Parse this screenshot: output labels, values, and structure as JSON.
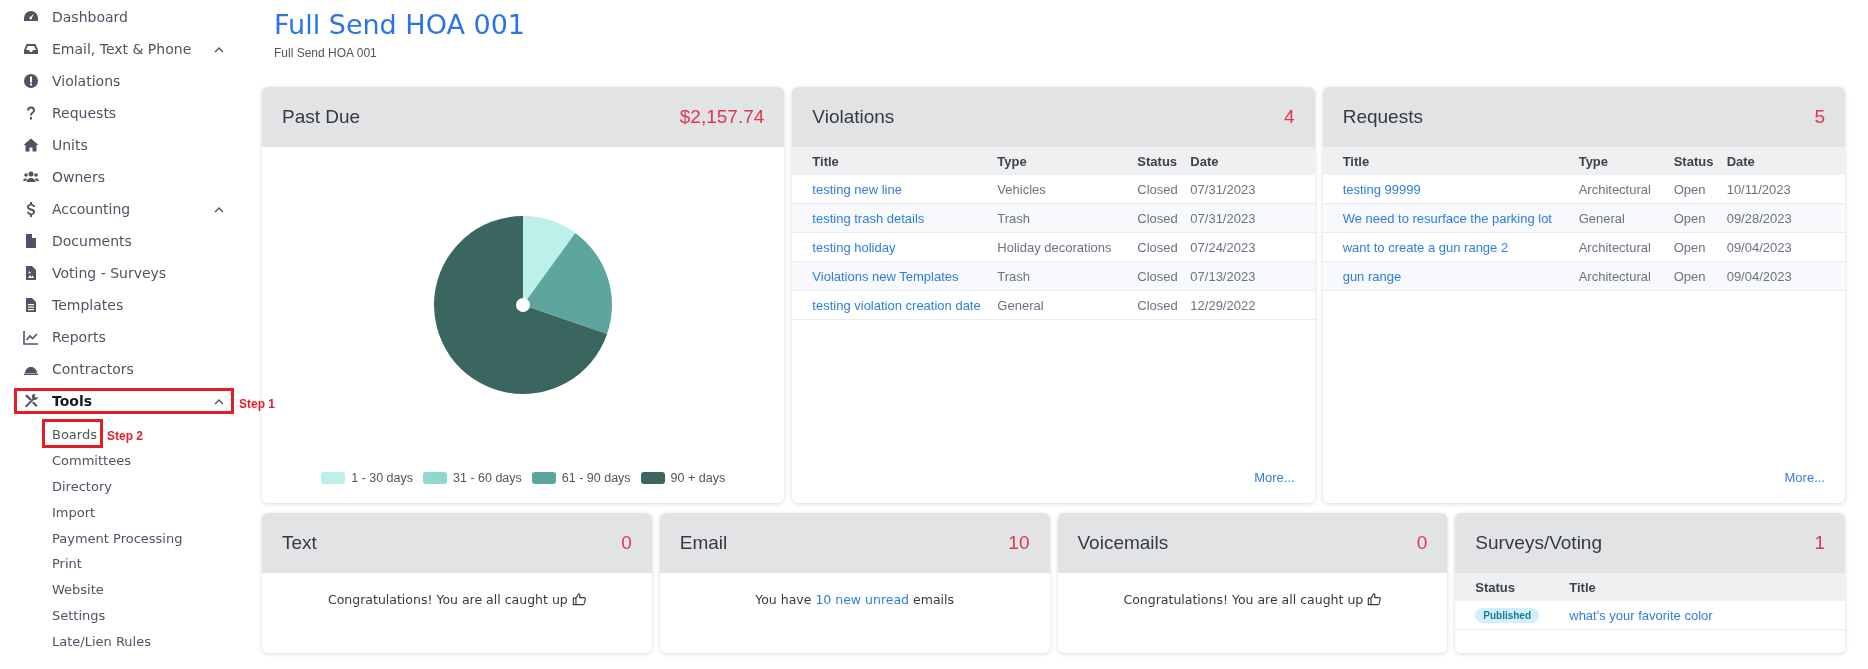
{
  "sidebar": {
    "items": [
      {
        "label": "Dashboard",
        "expanded": false,
        "active": false
      },
      {
        "label": "Email, Text & Phone",
        "expanded": true,
        "active": false
      },
      {
        "label": "Violations",
        "expanded": false,
        "active": false
      },
      {
        "label": "Requests",
        "expanded": false,
        "active": false
      },
      {
        "label": "Units",
        "expanded": false,
        "active": false
      },
      {
        "label": "Owners",
        "expanded": false,
        "active": false
      },
      {
        "label": "Accounting",
        "expanded": true,
        "active": false
      },
      {
        "label": "Documents",
        "expanded": false,
        "active": false
      },
      {
        "label": "Voting - Surveys",
        "expanded": false,
        "active": false
      },
      {
        "label": "Templates",
        "expanded": false,
        "active": false
      },
      {
        "label": "Reports",
        "expanded": false,
        "active": false
      },
      {
        "label": "Contractors",
        "expanded": false,
        "active": false
      },
      {
        "label": "Tools",
        "expanded": true,
        "active": true,
        "annotation": "Step 1",
        "children": [
          {
            "label": "Boards",
            "annotation": "Step 2"
          },
          {
            "label": "Committees"
          },
          {
            "label": "Directory"
          },
          {
            "label": "Import"
          },
          {
            "label": "Payment Processing"
          },
          {
            "label": "Print"
          },
          {
            "label": "Website"
          },
          {
            "label": "Settings"
          },
          {
            "label": "Late/Lien Rules"
          }
        ]
      }
    ]
  },
  "header": {
    "title": "Full Send HOA 001",
    "subtitle": "Full Send HOA 001"
  },
  "past_due": {
    "title": "Past Due",
    "total": "$2,157.74",
    "legend": [
      {
        "label": "1 - 30 days",
        "color": "#bdf0e8"
      },
      {
        "label": "31 - 60 days",
        "color": "#8fd8cc"
      },
      {
        "label": "61 - 90 days",
        "color": "#5ea69d"
      },
      {
        "label": "90 + days",
        "color": "#3a665f"
      }
    ]
  },
  "violations": {
    "title": "Violations",
    "count": "4",
    "columns": [
      "Title",
      "Type",
      "Status",
      "Date"
    ],
    "rows": [
      {
        "title": "testing new line",
        "type": "Vehicles",
        "status": "Closed",
        "date": "07/31/2023"
      },
      {
        "title": "testing trash details",
        "type": "Trash",
        "status": "Closed",
        "date": "07/31/2023"
      },
      {
        "title": "testing holiday",
        "type": "Holiday decorations",
        "status": "Closed",
        "date": "07/24/2023"
      },
      {
        "title": "Violations new Templates",
        "type": "Trash",
        "status": "Closed",
        "date": "07/13/2023"
      },
      {
        "title": "testing violation creation date",
        "type": "General",
        "status": "Closed",
        "date": "12/29/2022"
      }
    ],
    "more": "More..."
  },
  "requests": {
    "title": "Requests",
    "count": "5",
    "columns": [
      "Title",
      "Type",
      "Status",
      "Date"
    ],
    "rows": [
      {
        "title": "testing 99999",
        "type": "Architectural",
        "status": "Open",
        "date": "10/11/2023"
      },
      {
        "title": "We need to resurface the parking lot",
        "type": "General",
        "status": "Open",
        "date": "09/28/2023"
      },
      {
        "title": "want to create a gun range 2",
        "type": "Architectural",
        "status": "Open",
        "date": "09/04/2023"
      },
      {
        "title": "gun range",
        "type": "Architectural",
        "status": "Open",
        "date": "09/04/2023"
      }
    ],
    "more": "More..."
  },
  "mini_cards": [
    {
      "kind": "message",
      "title": "Text",
      "count": "0",
      "message": "Congratulations! You are all caught up"
    },
    {
      "kind": "link_message",
      "title": "Email",
      "count": "10",
      "before": "You have",
      "link": "10 new unread",
      "after": "emails"
    },
    {
      "kind": "message",
      "title": "Voicemails",
      "count": "0",
      "message": "Congratulations! You are all caught up"
    },
    {
      "kind": "table",
      "title": "Surveys/Voting",
      "count": "1",
      "columns": [
        "Status",
        "Title"
      ],
      "rows": [
        {
          "status": "Published",
          "title": "what's your favorite color"
        }
      ]
    }
  ]
}
